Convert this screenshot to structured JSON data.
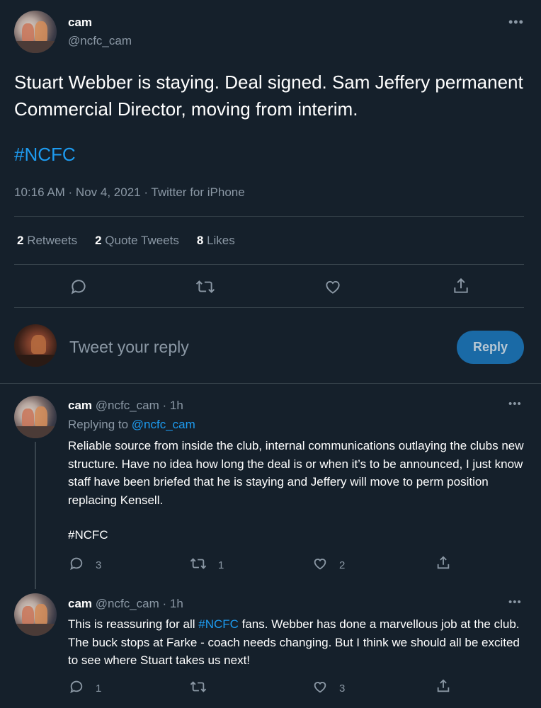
{
  "main_tweet": {
    "name": "cam",
    "handle": "@ncfc_cam",
    "text": "Stuart Webber is staying. Deal signed. Sam Jeffery permanent Commercial Director, moving from interim.",
    "hashtag": "#NCFC",
    "timestamp": "10:16 AM · Nov 4, 2021 · Twitter for iPhone",
    "stats": {
      "retweets_count": "2",
      "retweets_label": "Retweets",
      "quotes_count": "2",
      "quotes_label": "Quote Tweets",
      "likes_count": "8",
      "likes_label": "Likes"
    }
  },
  "reply_box": {
    "placeholder": "Tweet your reply",
    "button_label": "Reply"
  },
  "replies": [
    {
      "name": "cam",
      "handle": "@ncfc_cam",
      "time": "· 1h",
      "replying_to_label": "Replying to",
      "replying_to_handle": "@ncfc_cam",
      "text": "Reliable source from inside the club, internal communications outlaying the clubs new structure. Have no idea how long the deal is or when it’s to be announced, I just know staff have been briefed that he is staying and Jeffery will move to perm position replacing Kensell.",
      "hashtag": "#NCFC",
      "reply_count": "3",
      "retweet_count": "1",
      "like_count": "2"
    },
    {
      "name": "cam",
      "handle": "@ncfc_cam",
      "time": "· 1h",
      "text_before": "This is reassuring for all ",
      "hashtag": "#NCFC",
      "text_after": " fans. Webber has done a marvellous job at the club. The buck stops at Farke - coach needs changing. But I think we should all be excited to see where Stuart takes us next!",
      "reply_count": "1",
      "retweet_count": "",
      "like_count": "3"
    }
  ],
  "colors": {
    "background": "#15202b",
    "accent": "#1d9bf0",
    "muted": "#8b98a5",
    "divider": "#38444d"
  }
}
